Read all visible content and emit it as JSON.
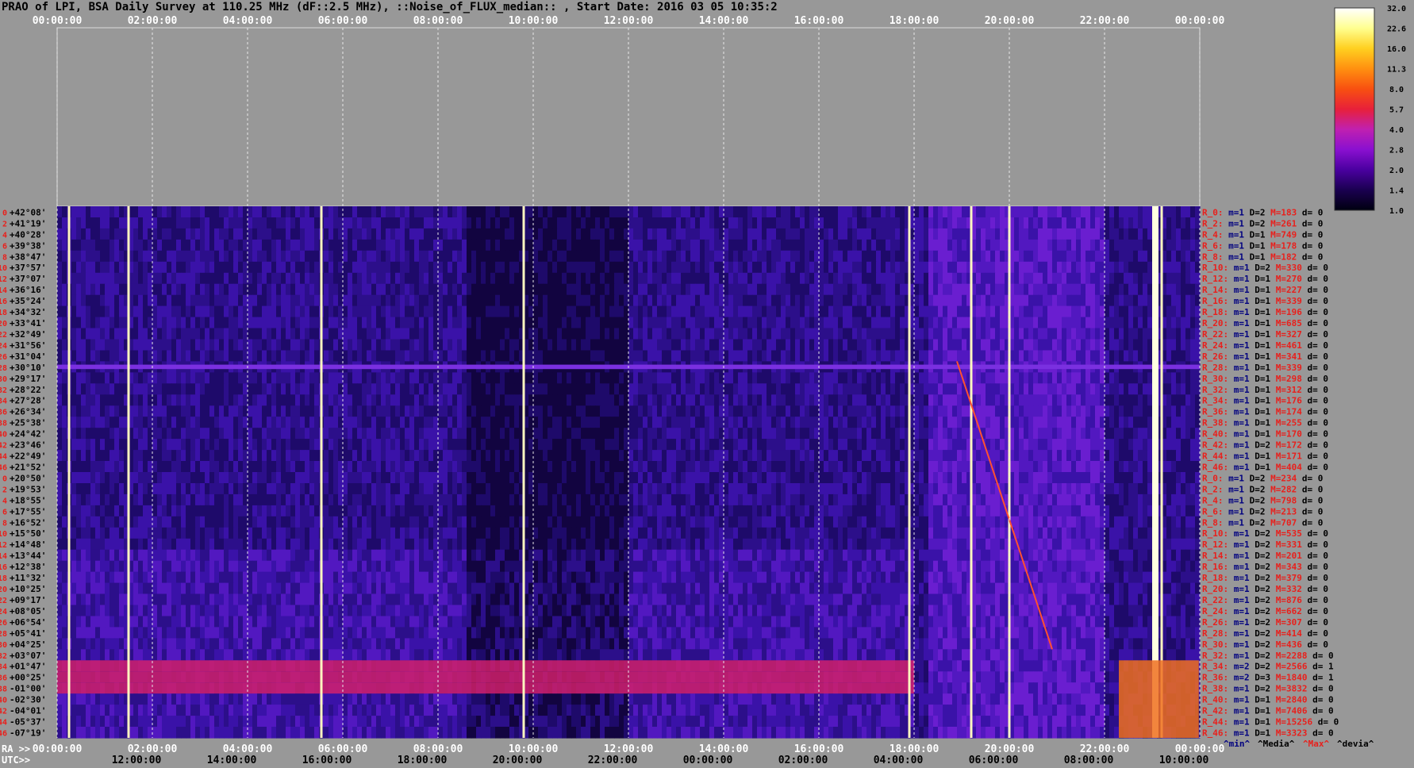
{
  "title": "PRAO of LPI, BSA Daily Survey at 110.25 MHz (dF::2.5 MHz), ::Noise_of_FLUX_median:: , Start Date: 2016 03 05 10:35:2",
  "chart_data": {
    "type": "heatmap",
    "title": "PRAO of LPI, BSA Daily Survey at 110.25 MHz (dF::2.5 MHz), ::Noise_of_FLUX_median:: , Start Date: 2016 03 05 10:35:2",
    "top_axis_ticks": [
      "00:00:00",
      "02:00:00",
      "04:00:00",
      "06:00:00",
      "08:00:00",
      "10:00:00",
      "12:00:00",
      "14:00:00",
      "16:00:00",
      "18:00:00",
      "20:00:00",
      "22:00:00",
      "00:00:00"
    ],
    "ra_axis_label": "RA >>",
    "ra_ticks": [
      "00:00:00",
      "02:00:00",
      "04:00:00",
      "06:00:00",
      "08:00:00",
      "10:00:00",
      "12:00:00",
      "14:00:00",
      "16:00:00",
      "18:00:00",
      "20:00:00",
      "22:00:00",
      "00:00:00"
    ],
    "utc_axis_label": "UTC>>",
    "utc_ticks": [
      "12:00:00",
      "14:00:00",
      "16:00:00",
      "18:00:00",
      "20:00:00",
      "22:00:00",
      "00:00:00",
      "02:00:00",
      "04:00:00",
      "06:00:00",
      "08:00:00",
      "10:00:00"
    ],
    "colorbar_ticks": [
      "32.0",
      "22.6",
      "16.0",
      "11.3",
      "8.0",
      "5.7",
      "4.0",
      "2.8",
      "2.0",
      "1.4",
      "1.0"
    ],
    "colorbar_colors": [
      "#000010",
      "#1a0050",
      "#4a00a0",
      "#8a10d0",
      "#c020b0",
      "#e8203a",
      "#f85010",
      "#ff9010",
      "#ffd020",
      "#ffff90",
      "#ffffff"
    ],
    "row_numbers": [
      "0",
      "2",
      "4",
      "6",
      "8",
      "10",
      "12",
      "14",
      "16",
      "18",
      "20",
      "22",
      "24",
      "26",
      "28",
      "30",
      "32",
      "34",
      "36",
      "38",
      "40",
      "42",
      "44",
      "46",
      "0",
      "2",
      "4",
      "6",
      "8",
      "10",
      "12",
      "14",
      "16",
      "18",
      "20",
      "22",
      "24",
      "26",
      "28",
      "30",
      "32",
      "34",
      "36",
      "38",
      "40",
      "42",
      "44",
      "46"
    ],
    "declinations": [
      "+42°08'",
      "+41°19'",
      "+40°28'",
      "+39°38'",
      "+38°47'",
      "+37°57'",
      "+37°07'",
      "+36°16'",
      "+35°24'",
      "+34°32'",
      "+33°41'",
      "+32°49'",
      "+31°56'",
      "+31°04'",
      "+30°10'",
      "+29°17'",
      "+28°22'",
      "+27°28'",
      "+26°34'",
      "+25°38'",
      "+24°42'",
      "+23°46'",
      "+22°49'",
      "+21°52'",
      "+20°50'",
      "+19°53'",
      "+18°55'",
      "+17°55'",
      "+16°52'",
      "+15°50'",
      "+14°48'",
      "+13°44'",
      "+12°38'",
      "+11°32'",
      "+10°25'",
      "+09°17'",
      "+08°05'",
      "+06°54'",
      "+05°41'",
      "+04°25'",
      "+03°07'",
      "+01°47'",
      "+00°25'",
      "-01°00'",
      "-02°30'",
      "-04°01'",
      "-05°37'",
      "-07°19'"
    ],
    "row_stats": [
      {
        "r": "R_0:",
        "m": "m=1",
        "D": "D=2",
        "M": "M=183",
        "d": "d= 0"
      },
      {
        "r": "R_2:",
        "m": "m=1",
        "D": "D=2",
        "M": "M=261",
        "d": "d= 0"
      },
      {
        "r": "R_4:",
        "m": "m=1",
        "D": "D=1",
        "M": "M=749",
        "d": "d= 0"
      },
      {
        "r": "R_6:",
        "m": "m=1",
        "D": "D=1",
        "M": "M=178",
        "d": "d= 0"
      },
      {
        "r": "R_8:",
        "m": "m=1",
        "D": "D=1",
        "M": "M=182",
        "d": "d= 0"
      },
      {
        "r": "R_10:",
        "m": "m=1",
        "D": "D=2",
        "M": "M=330",
        "d": "d= 0"
      },
      {
        "r": "R_12:",
        "m": "m=1",
        "D": "D=1",
        "M": "M=270",
        "d": "d= 0"
      },
      {
        "r": "R_14:",
        "m": "m=1",
        "D": "D=1",
        "M": "M=227",
        "d": "d= 0"
      },
      {
        "r": "R_16:",
        "m": "m=1",
        "D": "D=1",
        "M": "M=339",
        "d": "d= 0"
      },
      {
        "r": "R_18:",
        "m": "m=1",
        "D": "D=1",
        "M": "M=196",
        "d": "d= 0"
      },
      {
        "r": "R_20:",
        "m": "m=1",
        "D": "D=1",
        "M": "M=685",
        "d": "d= 0"
      },
      {
        "r": "R_22:",
        "m": "m=1",
        "D": "D=1",
        "M": "M=327",
        "d": "d= 0"
      },
      {
        "r": "R_24:",
        "m": "m=1",
        "D": "D=1",
        "M": "M=461",
        "d": "d= 0"
      },
      {
        "r": "R_26:",
        "m": "m=1",
        "D": "D=1",
        "M": "M=341",
        "d": "d= 0"
      },
      {
        "r": "R_28:",
        "m": "m=1",
        "D": "D=1",
        "M": "M=339",
        "d": "d= 0"
      },
      {
        "r": "R_30:",
        "m": "m=1",
        "D": "D=1",
        "M": "M=298",
        "d": "d= 0"
      },
      {
        "r": "R_32:",
        "m": "m=1",
        "D": "D=1",
        "M": "M=312",
        "d": "d= 0"
      },
      {
        "r": "R_34:",
        "m": "m=1",
        "D": "D=1",
        "M": "M=176",
        "d": "d= 0"
      },
      {
        "r": "R_36:",
        "m": "m=1",
        "D": "D=1",
        "M": "M=174",
        "d": "d= 0"
      },
      {
        "r": "R_38:",
        "m": "m=1",
        "D": "D=1",
        "M": "M=255",
        "d": "d= 0"
      },
      {
        "r": "R_40:",
        "m": "m=1",
        "D": "D=1",
        "M": "M=170",
        "d": "d= 0"
      },
      {
        "r": "R_42:",
        "m": "m=1",
        "D": "D=2",
        "M": "M=172",
        "d": "d= 0"
      },
      {
        "r": "R_44:",
        "m": "m=1",
        "D": "D=1",
        "M": "M=171",
        "d": "d= 0"
      },
      {
        "r": "R_46:",
        "m": "m=1",
        "D": "D=1",
        "M": "M=404",
        "d": "d= 0"
      },
      {
        "r": "R_0:",
        "m": "m=1",
        "D": "D=2",
        "M": "M=234",
        "d": "d= 0"
      },
      {
        "r": "R_2:",
        "m": "m=1",
        "D": "D=2",
        "M": "M=282",
        "d": "d= 0"
      },
      {
        "r": "R_4:",
        "m": "m=1",
        "D": "D=2",
        "M": "M=798",
        "d": "d= 0"
      },
      {
        "r": "R_6:",
        "m": "m=1",
        "D": "D=2",
        "M": "M=213",
        "d": "d= 0"
      },
      {
        "r": "R_8:",
        "m": "m=1",
        "D": "D=2",
        "M": "M=707",
        "d": "d= 0"
      },
      {
        "r": "R_10:",
        "m": "m=1",
        "D": "D=2",
        "M": "M=535",
        "d": "d= 0"
      },
      {
        "r": "R_12:",
        "m": "m=1",
        "D": "D=2",
        "M": "M=331",
        "d": "d= 0"
      },
      {
        "r": "R_14:",
        "m": "m=1",
        "D": "D=2",
        "M": "M=201",
        "d": "d= 0"
      },
      {
        "r": "R_16:",
        "m": "m=1",
        "D": "D=2",
        "M": "M=343",
        "d": "d= 0"
      },
      {
        "r": "R_18:",
        "m": "m=1",
        "D": "D=2",
        "M": "M=379",
        "d": "d= 0"
      },
      {
        "r": "R_20:",
        "m": "m=1",
        "D": "D=2",
        "M": "M=332",
        "d": "d= 0"
      },
      {
        "r": "R_22:",
        "m": "m=1",
        "D": "D=2",
        "M": "M=876",
        "d": "d= 0"
      },
      {
        "r": "R_24:",
        "m": "m=1",
        "D": "D=2",
        "M": "M=662",
        "d": "d= 0"
      },
      {
        "r": "R_26:",
        "m": "m=1",
        "D": "D=2",
        "M": "M=307",
        "d": "d= 0"
      },
      {
        "r": "R_28:",
        "m": "m=1",
        "D": "D=2",
        "M": "M=414",
        "d": "d= 0"
      },
      {
        "r": "R_30:",
        "m": "m=1",
        "D": "D=2",
        "M": "M=436",
        "d": "d= 0"
      },
      {
        "r": "R_32:",
        "m": "m=1",
        "D": "D=2",
        "M": "M=2288",
        "d": "d= 0"
      },
      {
        "r": "R_34:",
        "m": "m=2",
        "D": "D=2",
        "M": "M=2566",
        "d": "d= 1"
      },
      {
        "r": "R_36:",
        "m": "m=2",
        "D": "D=3",
        "M": "M=1840",
        "d": "d= 1"
      },
      {
        "r": "R_38:",
        "m": "m=1",
        "D": "D=2",
        "M": "M=3832",
        "d": "d= 0"
      },
      {
        "r": "R_40:",
        "m": "m=1",
        "D": "D=1",
        "M": "M=2840",
        "d": "d= 0"
      },
      {
        "r": "R_42:",
        "m": "m=1",
        "D": "D=1",
        "M": "M=7406",
        "d": "d= 0"
      },
      {
        "r": "R_44:",
        "m": "m=1",
        "D": "D=1",
        "M": "M=15256",
        "d": "d= 0"
      },
      {
        "r": "R_46:",
        "m": "m=1",
        "D": "D=1",
        "M": "M=3323",
        "d": "d= 0"
      }
    ],
    "stats_legend": [
      "^min^",
      "^Media^",
      "^Max^",
      "^devia^"
    ],
    "bright_columns_ra_hours": [
      0.25,
      1.5,
      5.55,
      9.8,
      17.9,
      19.2,
      20.0,
      23.2
    ],
    "interference_band_rows": [
      41,
      42,
      43
    ]
  }
}
